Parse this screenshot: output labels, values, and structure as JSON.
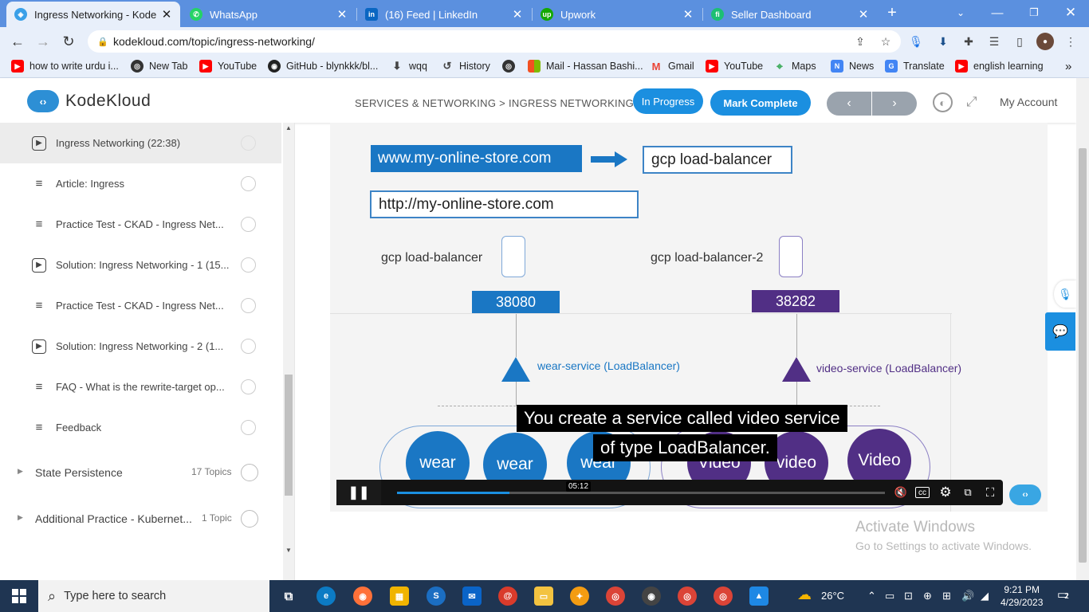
{
  "browser": {
    "tabs": [
      {
        "title": "Ingress Networking - KodeKl",
        "icon": "kodekloud-icon",
        "color": "#3aa0e8",
        "active": true
      },
      {
        "title": "WhatsApp",
        "icon": "whatsapp-icon",
        "color": "#25d366",
        "active": false
      },
      {
        "title": "(16) Feed | LinkedIn",
        "icon": "linkedin-icon",
        "color": "#0a66c2",
        "active": false
      },
      {
        "title": "Upwork",
        "icon": "upwork-icon",
        "color": "#14a800",
        "active": false
      },
      {
        "title": "Seller Dashboard",
        "icon": "fiverr-icon",
        "color": "#1dbf73",
        "active": false
      }
    ],
    "url": "kodekloud.com/topic/ingress-networking/",
    "bookmarks": [
      {
        "label": "how to write urdu i...",
        "icon": "youtube-icon",
        "color": "#ff0000"
      },
      {
        "label": "New Tab",
        "icon": "globe-icon",
        "color": "#333333"
      },
      {
        "label": "YouTube",
        "icon": "youtube-icon",
        "color": "#ff0000"
      },
      {
        "label": "GitHub - blynkkk/bl...",
        "icon": "github-icon",
        "color": "#222222"
      },
      {
        "label": "wqq",
        "icon": "download-icon",
        "color": "#444444"
      },
      {
        "label": "History",
        "icon": "history-icon",
        "color": "#444444"
      },
      {
        "label": "",
        "icon": "globe-icon",
        "color": "#333333"
      },
      {
        "label": "Mail - Hassan Bashi...",
        "icon": "microsoft-icon",
        "color": "#f25022"
      },
      {
        "label": "Gmail",
        "icon": "gmail-icon",
        "color": "#ea4335"
      },
      {
        "label": "YouTube",
        "icon": "youtube-icon",
        "color": "#ff0000"
      },
      {
        "label": "Maps",
        "icon": "maps-icon",
        "color": "#34a853"
      },
      {
        "label": "News",
        "icon": "news-icon",
        "color": "#4285f4"
      },
      {
        "label": "Translate",
        "icon": "translate-icon",
        "color": "#4285f4"
      },
      {
        "label": "english learning",
        "icon": "youtube-icon",
        "color": "#ff0000"
      }
    ],
    "bookmarks_more": "»"
  },
  "site": {
    "logo_text": "KodeKloud",
    "breadcrumb": "SERVICES & NETWORKING > INGRESS NETWORKING",
    "in_progress_label": "In Progress",
    "mark_complete_label": "Mark Complete",
    "prev_label": "‹",
    "next_label": "›",
    "account_label": "My Account",
    "accent": "#1b8fe0"
  },
  "sidebar": {
    "lessons": [
      {
        "label": "Ingress Networking (22:38)",
        "type": "video",
        "active": true
      },
      {
        "label": "Article: Ingress",
        "type": "article",
        "active": false
      },
      {
        "label": "Practice Test - CKAD - Ingress Net...",
        "type": "article",
        "active": false
      },
      {
        "label": "Solution: Ingress Networking - 1 (15...",
        "type": "video",
        "active": false
      },
      {
        "label": "Practice Test - CKAD - Ingress Net...",
        "type": "article",
        "active": false
      },
      {
        "label": "Solution: Ingress Networking - 2 (1...",
        "type": "video",
        "active": false
      },
      {
        "label": "FAQ - What is the rewrite-target op...",
        "type": "article",
        "active": false
      },
      {
        "label": "Feedback",
        "type": "article",
        "active": false
      }
    ],
    "sections": [
      {
        "title": "State Persistence",
        "count": "17 Topics"
      },
      {
        "title": "Additional Practice - Kubernet...",
        "count": "1 Topic"
      }
    ]
  },
  "video": {
    "domain_blue": "www.my-online-store.com",
    "lb_box": "gcp load-balancer",
    "http_box": "http://my-online-store.com",
    "lb1": "gcp load-balancer",
    "lb2": "gcp load-balancer-2",
    "port1": "38080",
    "port2": "38282",
    "svc1": "wear-service (LoadBalancer)",
    "svc2": "video-service (LoadBalancer)",
    "pods_wear": [
      "wear",
      "wear",
      "wear"
    ],
    "pods_video": [
      "Video",
      "video",
      "Video"
    ],
    "caption_line1": "You create a service called video service",
    "caption_line2": "of type LoadBalancer.",
    "time_tooltip": "05:12",
    "progress": 0.23,
    "colors": {
      "blue": "#1a77c4",
      "purple": "#512f85"
    }
  },
  "activate": {
    "line1": "Activate Windows",
    "line2": "Go to Settings to activate Windows."
  },
  "taskbar": {
    "search_placeholder": "Type here to search",
    "weather": "26°C",
    "time": "9:21 PM",
    "date": "4/29/2023",
    "notifications": "2"
  }
}
